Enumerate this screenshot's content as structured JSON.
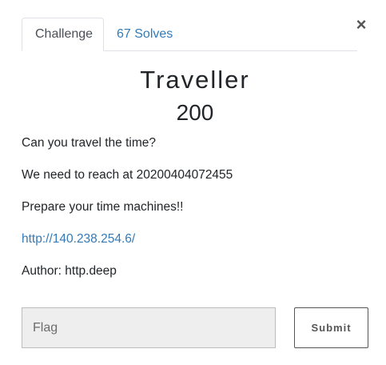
{
  "modal": {
    "close_label": "×",
    "tabs": [
      {
        "label": "Challenge",
        "active": true
      },
      {
        "label": "67 Solves",
        "active": false
      }
    ],
    "challenge": {
      "name": "Traveller",
      "value": "200",
      "description": [
        "Can you travel the time?",
        "We need to reach at 20200404072455",
        "Prepare your time machines!!"
      ],
      "link": "http://140.238.254.6/",
      "author": "Author: http.deep"
    },
    "flag": {
      "value": "",
      "placeholder": "Flag"
    },
    "submit_label": "Submit"
  },
  "colors": {
    "link": "#337ab7",
    "input_bg": "#eeeeee",
    "text": "#212529"
  }
}
